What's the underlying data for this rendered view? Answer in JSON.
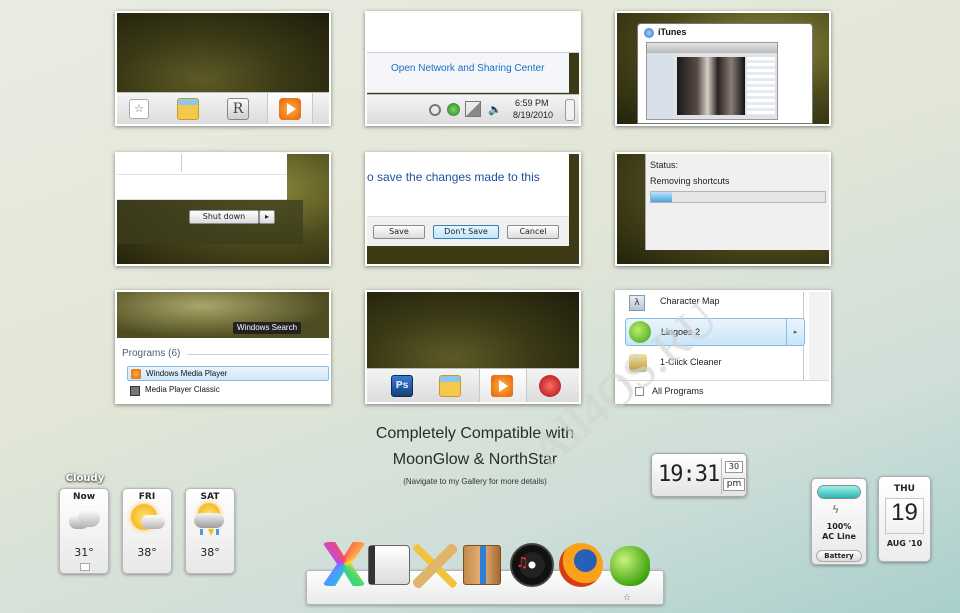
{
  "tiles": {
    "t1": {},
    "t2": {
      "link": "Open Network and Sharing Center",
      "time": "6:59 PM",
      "date": "8/19/2010"
    },
    "t3": {
      "title": "iTunes"
    },
    "t4": {
      "shutdown": "Shut down"
    },
    "t5": {
      "prompt": "o save the changes made to this",
      "save": "Save",
      "dont_save": "Don't Save",
      "cancel": "Cancel"
    },
    "t6": {
      "status_label": "Status:",
      "status_text": "Removing shortcuts",
      "progress": 0.12
    },
    "t7": {
      "search_label": "Windows Search",
      "group": "Programs (6)",
      "items": [
        "Windows Media Player",
        "Media Player Classic"
      ]
    },
    "t8": {},
    "t9": {
      "items": [
        "Character Map",
        "Lingoes 2",
        "1-Click Cleaner"
      ],
      "all_programs": "All Programs"
    }
  },
  "caption": {
    "line1": "Completely Compatible with",
    "line2": "MoonGlow & NorthStar",
    "line3": "(Navigate to my Gallery for more details)"
  },
  "watermark": "All4OS.RU",
  "weather": {
    "condition": "Cloudy",
    "days": [
      {
        "day": "Now",
        "temp": "31°",
        "icon": "cloud-icon"
      },
      {
        "day": "FRI",
        "temp": "38°",
        "icon": "sun-cloud-icon"
      },
      {
        "day": "SAT",
        "temp": "38°",
        "icon": "storm-icon"
      }
    ]
  },
  "clock": {
    "time": "19:31",
    "seconds": "30",
    "ampm": "pm"
  },
  "battery": {
    "percent": "100%",
    "source": "AC Line",
    "label": "Battery",
    "level": 1.0
  },
  "calendar": {
    "weekday": "THU",
    "day": "19",
    "month_year": "AUG '10"
  },
  "colors": {
    "accent_blue": "#1a6fc4",
    "progress_blue": "#4aa3e0",
    "battery_teal": "#2bb5b0"
  }
}
